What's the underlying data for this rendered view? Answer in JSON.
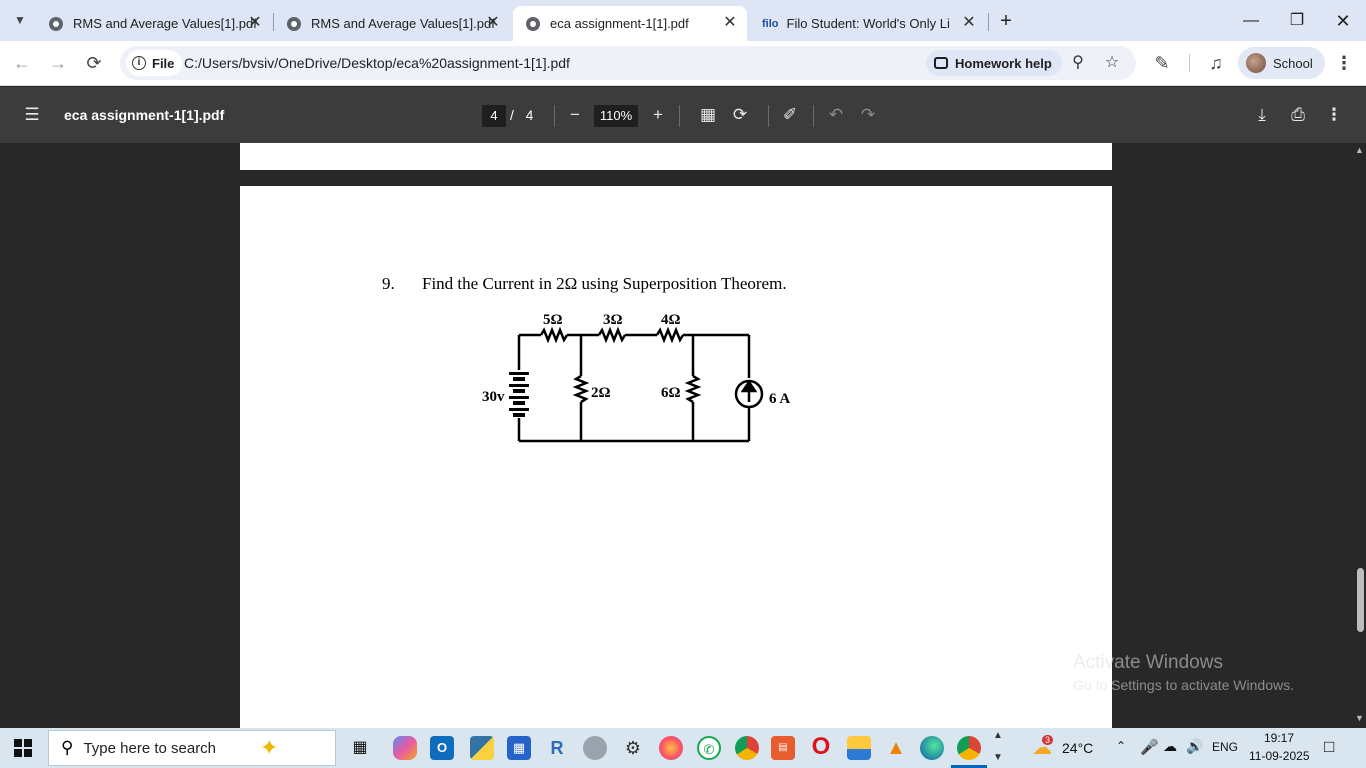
{
  "browser": {
    "tabs": [
      {
        "title": "RMS and Average Values[1].pdf",
        "active": false
      },
      {
        "title": "RMS and Average Values[1].pdf",
        "active": false
      },
      {
        "title": "eca assignment-1[1].pdf",
        "active": true
      },
      {
        "title": "Filo Student: World's Only Live",
        "active": false,
        "favicon_text": "filo"
      }
    ],
    "new_tab": "+",
    "file_chip": "File",
    "url": "C:/Users/bvsiv/OneDrive/Desktop/eca%20assignment-1[1].pdf",
    "homework_help": "Homework help",
    "profile_label": "School"
  },
  "pdf_toolbar": {
    "doc_title": "eca assignment-1[1].pdf",
    "current_page": "4",
    "page_separator": "/",
    "total_pages": "4",
    "zoom": "110%"
  },
  "document": {
    "question_number": "9.",
    "question_text": "Find the Current in 2Ω using Superposition Theorem.",
    "circuit": {
      "series_resistors": [
        "5Ω",
        "3Ω",
        "4Ω"
      ],
      "source_voltage": "30v",
      "shunt_resistor_1": "2Ω",
      "shunt_resistor_2": "6Ω",
      "current_source": "6 A"
    }
  },
  "watermark": {
    "line1": "Activate Windows",
    "line2": "Go to Settings to activate Windows."
  },
  "taskbar": {
    "search_placeholder": "Type here to search",
    "weather_temp": "24°C",
    "weather_badge": "3",
    "language": "ENG",
    "time": "19:17",
    "date": "11-09-2025"
  },
  "colors": {
    "tabstrip_bg": "#dee6f5",
    "pdf_toolbar_bg": "#3c3c3c",
    "viewer_bg": "#282828",
    "taskbar_bg": "#d9e6ef"
  }
}
